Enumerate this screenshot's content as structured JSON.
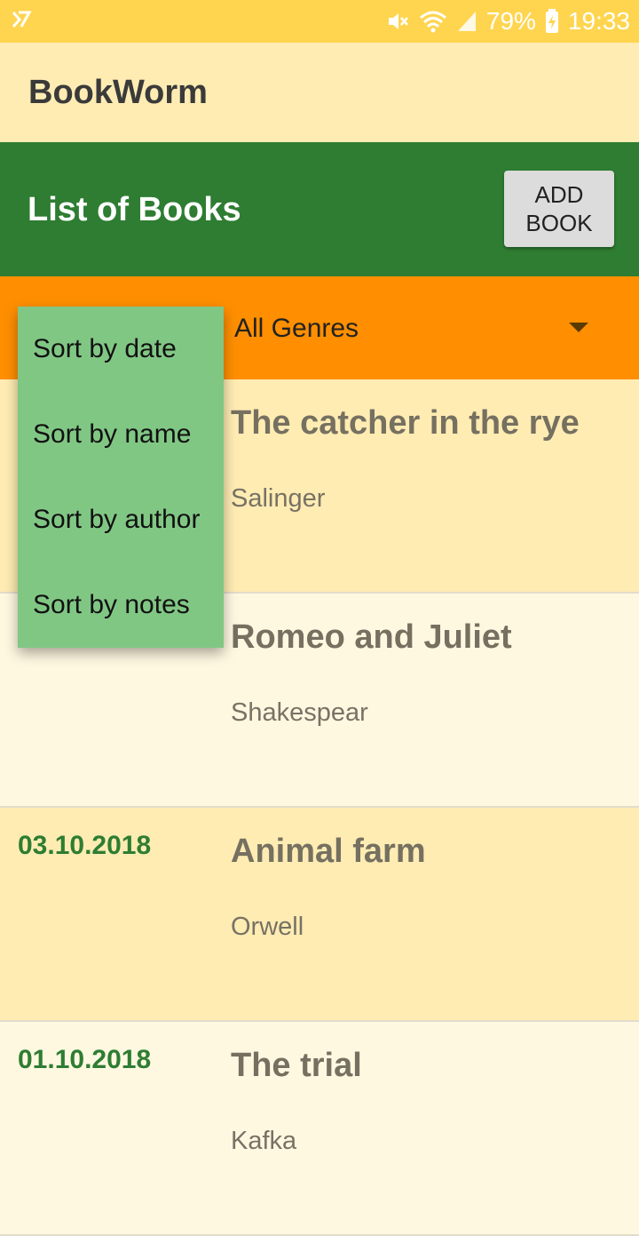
{
  "status_bar": {
    "battery": "79%",
    "time": "19:33",
    "icons": [
      "app-notification-icon",
      "mute-icon",
      "wifi-icon",
      "signal-icon",
      "battery-charging-icon"
    ]
  },
  "app": {
    "title": "BookWorm"
  },
  "header": {
    "title": "List of Books",
    "add_button": "ADD\nBOOK"
  },
  "filter": {
    "genre_selected": "All Genres"
  },
  "sort_menu": {
    "items": [
      "Sort by date",
      "Sort by name",
      "Sort by author",
      "Sort by notes"
    ]
  },
  "books": [
    {
      "date": "",
      "title": "The catcher in the rye",
      "author": "Salinger"
    },
    {
      "date": "",
      "title": "Romeo and Juliet",
      "author": "Shakespear"
    },
    {
      "date": "03.10.2018",
      "title": "Animal farm",
      "author": "Orwell"
    },
    {
      "date": "01.10.2018",
      "title": "The trial",
      "author": "Kafka"
    }
  ],
  "colors": {
    "status_bar": "#ffd54f",
    "app_bar": "#ffecb3",
    "header": "#2e7d32",
    "filter_bar": "#ff8f00",
    "menu": "#81c784",
    "row_odd": "#ffecb3",
    "row_even": "#fff8e1",
    "date_text": "#2e7d32"
  }
}
